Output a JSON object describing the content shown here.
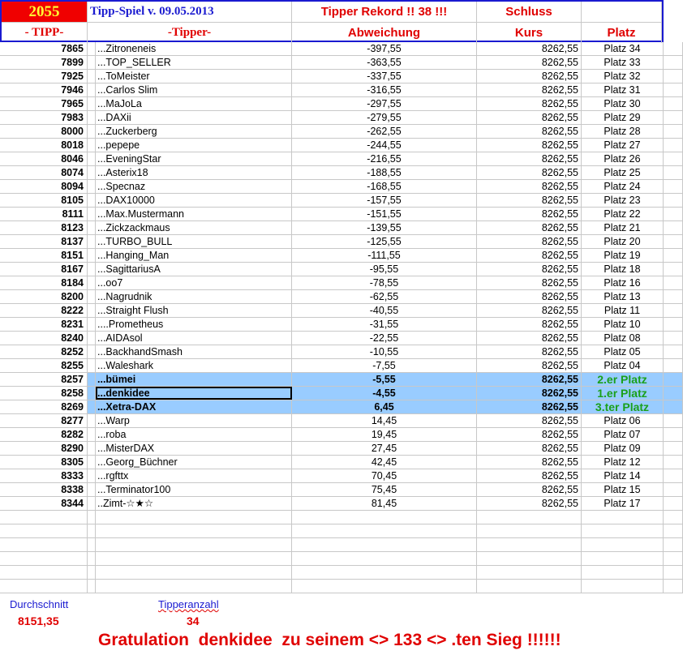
{
  "header": {
    "number": "2055",
    "title": "Tipp-Spiel v. 09.05.2013",
    "rekord": "Tipper Rekord !!  38  !!!",
    "schluss": "Schluss",
    "col_tipp": "- TIPP-",
    "col_tipper": "-Tipper-",
    "col_abw": "Abweichung",
    "col_kurs": "Kurs",
    "col_platz": "Platz"
  },
  "rows": [
    [
      "7865",
      "...Zitroneneis",
      "-397,55",
      "8262,55",
      "Platz 34"
    ],
    [
      "7899",
      "...TOP_SELLER",
      "-363,55",
      "8262,55",
      "Platz 33"
    ],
    [
      "7925",
      "...ToMeister",
      "-337,55",
      "8262,55",
      "Platz 32"
    ],
    [
      "7946",
      "...Carlos Slim",
      "-316,55",
      "8262,55",
      "Platz 31"
    ],
    [
      "7965",
      "...MaJoLa",
      "-297,55",
      "8262,55",
      "Platz 30"
    ],
    [
      "7983",
      "...DAXii",
      "-279,55",
      "8262,55",
      "Platz 29"
    ],
    [
      "8000",
      "...Zuckerberg",
      "-262,55",
      "8262,55",
      "Platz 28"
    ],
    [
      "8018",
      "...pepepe",
      "-244,55",
      "8262,55",
      "Platz 27"
    ],
    [
      "8046",
      "...EveningStar",
      "-216,55",
      "8262,55",
      "Platz 26"
    ],
    [
      "8074",
      "...Asterix18",
      "-188,55",
      "8262,55",
      "Platz 25"
    ],
    [
      "8094",
      "...Specnaz",
      "-168,55",
      "8262,55",
      "Platz 24"
    ],
    [
      "8105",
      "...DAX10000",
      "-157,55",
      "8262,55",
      "Platz 23"
    ],
    [
      "8111",
      "...Max.Mustermann",
      "-151,55",
      "8262,55",
      "Platz 22"
    ],
    [
      "8123",
      "...Zickzackmaus",
      "-139,55",
      "8262,55",
      "Platz 21"
    ],
    [
      "8137",
      "...TURBO_BULL",
      "-125,55",
      "8262,55",
      "Platz 20"
    ],
    [
      "8151",
      "...Hanging_Man",
      "-111,55",
      "8262,55",
      "Platz 19"
    ],
    [
      "8167",
      "...SagittariusA",
      "-95,55",
      "8262,55",
      "Platz 18"
    ],
    [
      "8184",
      "...oo7",
      "-78,55",
      "8262,55",
      "Platz 16"
    ],
    [
      "8200",
      "...Nagrudnik",
      "-62,55",
      "8262,55",
      "Platz 13"
    ],
    [
      "8222",
      "...Straight Flush",
      "-40,55",
      "8262,55",
      "Platz 11"
    ],
    [
      "8231",
      "....Prometheus",
      "-31,55",
      "8262,55",
      "Platz 10"
    ],
    [
      "8240",
      "...AIDAsol",
      "-22,55",
      "8262,55",
      "Platz 08"
    ],
    [
      "8252",
      "...BackhandSmash",
      "-10,55",
      "8262,55",
      "Platz 05"
    ],
    [
      "8255",
      "...Waleshark",
      "-7,55",
      "8262,55",
      "Platz 04"
    ],
    [
      "8257",
      "...bümei",
      "-5,55",
      "8262,55",
      "2.er Platz"
    ],
    [
      "8258",
      "...denkidee",
      "-4,55",
      "8262,55",
      "1.er Platz"
    ],
    [
      "8269",
      "...Xetra-DAX",
      "6,45",
      "8262,55",
      "3.ter Platz"
    ],
    [
      "8277",
      "...Warp",
      "14,45",
      "8262,55",
      "Platz 06"
    ],
    [
      "8282",
      "...roba",
      "19,45",
      "8262,55",
      "Platz 07"
    ],
    [
      "8290",
      "...MisterDAX",
      "27,45",
      "8262,55",
      "Platz 09"
    ],
    [
      "8305",
      "...Georg_Büchner",
      "42,45",
      "8262,55",
      "Platz 12"
    ],
    [
      "8333",
      "...rgfttx",
      "70,45",
      "8262,55",
      "Platz 14"
    ],
    [
      "8338",
      "...Terminator100",
      "75,45",
      "8262,55",
      "Platz 15"
    ],
    [
      "8344",
      "..Zimt-☆★☆",
      "81,45",
      "8262,55",
      "Platz 17"
    ]
  ],
  "highlight": [
    24,
    25,
    26
  ],
  "selected": 25,
  "footer": {
    "avg_label": "Durchschnitt",
    "avg_value": "8151,35",
    "count_label": "Tipperanzahl",
    "count_value": "34",
    "gratulation": "Gratulation  denkidee  zu seinem <> 133 <> .ten Sieg !!!!!!"
  }
}
